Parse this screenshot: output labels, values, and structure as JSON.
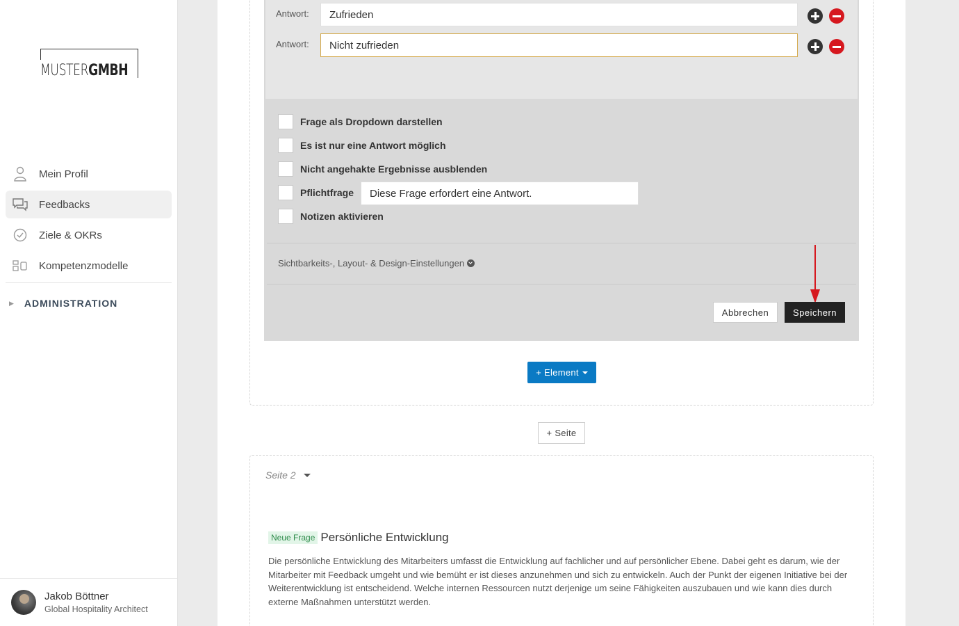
{
  "sidebar": {
    "logo": {
      "part1": "MUSTER",
      "part2": "GMBH"
    },
    "nav": [
      {
        "label": "Mein Profil",
        "icon": "user-icon"
      },
      {
        "label": "Feedbacks",
        "icon": "chat-bubbles-icon"
      },
      {
        "label": "Ziele & OKRs",
        "icon": "check-circle-icon"
      },
      {
        "label": "Kompetenzmodelle",
        "icon": "grid-model-icon"
      }
    ],
    "admin_label": "ADMINISTRATION",
    "user": {
      "name": "Jakob Böttner",
      "role": "Global Hospitality Architect"
    }
  },
  "editor": {
    "answers": [
      {
        "label": "Antwort:",
        "value": "Zufrieden"
      },
      {
        "label": "Antwort:",
        "value": "Nicht zufrieden"
      }
    ],
    "options": [
      {
        "label": "Frage als Dropdown darstellen",
        "checked": false
      },
      {
        "label": "Es ist nur eine Antwort möglich",
        "checked": false
      },
      {
        "label": "Nicht angehakte Ergebnisse ausblenden",
        "checked": false
      },
      {
        "label": "Pflichtfrage",
        "checked": false
      },
      {
        "label": "Notizen aktivieren",
        "checked": false
      }
    ],
    "required_message": "Diese Frage erfordert eine Antwort.",
    "visibility_link": "Sichtbarkeits-, Layout- & Design-Einstellungen",
    "cancel_label": "Abbrechen",
    "save_label": "Speichern"
  },
  "add_element_label": "+ Element",
  "add_page_label": "+ Seite",
  "page2": {
    "label": "Seite 2",
    "badge": "Neue Frage",
    "question_title": "Persönliche Entwicklung",
    "description": "Die persönliche Entwicklung des Mitarbeiters umfasst die Entwicklung auf fachlicher und auf persönlicher Ebene. Dabei geht es darum, wie der Mitarbeiter mit Feedback umgeht und wie bemüht er ist dieses anzunehmen und sich zu entwickeln. Auch der Punkt der eigenen Initiative bei der Weiterentwicklung ist entscheidend. Welche internen Ressourcen nutzt derjenige um seine Fähigkeiten auszubauen und wie kann dies durch externe Maßnahmen unterstützt werden."
  },
  "colors": {
    "primary_button": "#0a7ac4",
    "save_button": "#222222",
    "remove_icon": "#d6181f",
    "focus_border": "#d4a94a",
    "annotation_arrow": "#d6181f"
  }
}
